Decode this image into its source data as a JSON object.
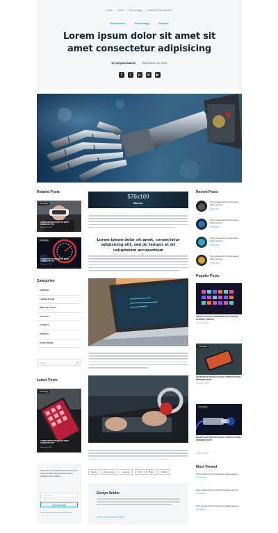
{
  "breadcrumb": [
    "Home",
    "Area",
    "Technology",
    "Nobis Et Nihil Dolorib..."
  ],
  "breadcrumb_sep": "›",
  "categories_top": [
    "Electronics",
    "Technology",
    "Gizmos"
  ],
  "title": "Lorem ipsum dolor sit amet sit amet consectetur adipisicing",
  "meta": {
    "author": "by Clayton Adams",
    "date": "September 15, 2022"
  },
  "social": [
    {
      "icon": "facebook-icon",
      "glyph": "f"
    },
    {
      "icon": "twitter-icon",
      "glyph": "t"
    },
    {
      "icon": "pinterest-icon",
      "glyph": "p"
    },
    {
      "icon": "linkedin-icon",
      "glyph": "in"
    },
    {
      "icon": "youtube-icon",
      "glyph": "▶"
    }
  ],
  "left": {
    "related_title": "Related Posts",
    "related": [
      {
        "tag": "Technology",
        "caption": "LOREM IPSUM DOLOR SIT AMET CONSECTETUR",
        "date": "February 8, 2022"
      },
      {
        "tag": "Technology",
        "caption": "LOREM IPSUM DOLOR SIT AMET CONSECTETUR",
        "date": "February 8, 2022"
      }
    ],
    "categories_title": "Categories",
    "categories": [
      "VERSION",
      "LOREM IPSUM",
      "NIBH VEL VELIT",
      "AUCTOR",
      "ALIQUET",
      "SCREAN",
      "EVOLUTIONS"
    ],
    "search_placeholder": "Search ...",
    "latest_title": "Latest Posts",
    "latest": {
      "tag": "Technology",
      "caption": "LOREM IPSUM DOLOR SIT AMET CONSECTETUR",
      "date": "February 8, 2022"
    },
    "newsletter_text": "Subscribe to our Mailchimp newsletter and stay up to date with all events coming straight in your mailbox:",
    "newsletter_placeholder": "Your email",
    "subscribe_label": "SUBSCRIBE",
    "newsletter_note": "I have read and agree to the terms & conditions"
  },
  "center": {
    "banner_size": "570x100",
    "banner_label": "Banner",
    "heading": "Lorem ipsum dolor sit amet, consectetur adipisicing elit, sed do tempor et sit voluptatem accusantium",
    "tags": [
      "Media",
      "Accessories",
      "Laptops",
      "Tech",
      "Basic",
      "Mobile"
    ],
    "author_name": "Evelyn Snider",
    "author_link": "+ More articles by Evelyn Snider"
  },
  "right": {
    "recent_title": "Recent Posts",
    "recent": [
      {
        "text": "Proin gravida nibh vel velit auctor aliquet aenean...",
        "date": "27 Mar 2022"
      },
      {
        "text": "Proin gravida nibh vel velit auctor aliquet aenean...",
        "date": "27 Mar 2022"
      },
      {
        "text": "Proin gravida nibh vel velit auctor aliquet aenean...",
        "date": "27 Mar 2022"
      },
      {
        "text": "Proin gravida nibh vel velit auctor aliquet aenean...",
        "date": "27 Mar 2022"
      }
    ],
    "popular_title": "Popular Posts",
    "popular": [
      {
        "tag": "",
        "caption": "CONSECTETUR SUSPENDISSE ELIT SED DO EIUSMOD TEMPOR",
        "date": "February 8, 2022"
      },
      {
        "tag": "Technology",
        "caption": "EXCEPTEUR SINT OCCAECAT CUPIDATAT NON PROIDENT SUNT",
        "date": "February 8, 2022"
      },
      {
        "tag": "Technology",
        "caption": "EXCEPTEUR SINT OCCAECAT CUPIDATAT NON PROIDENT SUNT",
        "date": "February 8, 2022"
      }
    ],
    "most_viewed_title": "Most Viewed",
    "most_viewed": [
      {
        "text": "Proin gravida nibh vel velit auctor aliquet aenean...",
        "date": "27 Mar 2022"
      },
      {
        "text": "Proin gravida nibh vel velit auctor aliquet aenean...",
        "date": "27 Mar 2022"
      },
      {
        "text": "Proin gravida nibh vel velit auctor aliquet aenean...",
        "date": "27 Mar 2022"
      }
    ]
  },
  "colors": {
    "accent": "#19a9c9",
    "heading": "#1d2432",
    "band": "#f3f5f7"
  }
}
